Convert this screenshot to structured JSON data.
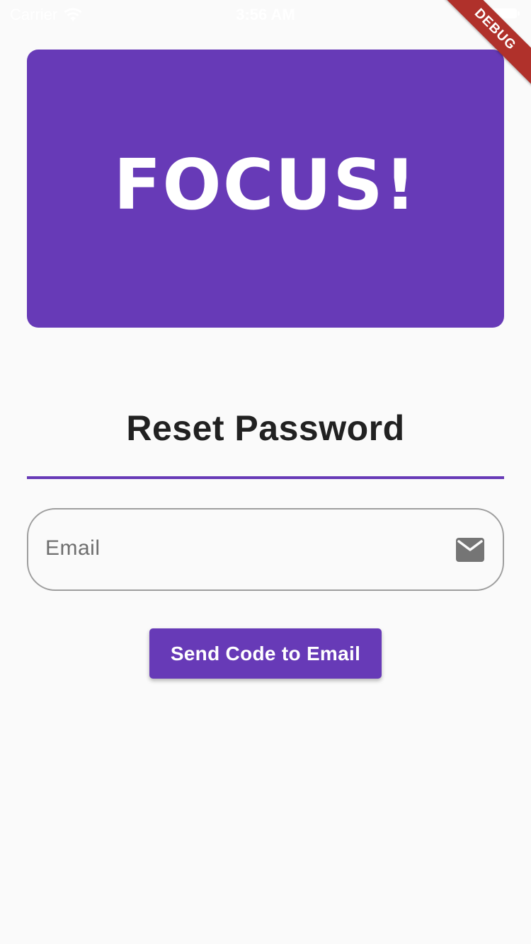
{
  "status_bar": {
    "carrier": "Carrier",
    "time": "3:56 AM",
    "wifi_icon": "wifi-icon",
    "battery_icon": "battery-icon"
  },
  "debug_banner": {
    "label": "DEBUG",
    "color": "#b0312b"
  },
  "hero": {
    "logo_text": "FOCUS!",
    "background_color": "#673ab7"
  },
  "form": {
    "title": "Reset Password",
    "email_field": {
      "placeholder": "Email",
      "value": "",
      "icon": "mail-icon"
    },
    "submit_label": "Send Code to Email"
  },
  "colors": {
    "accent": "#673ab7",
    "background": "#fafafa",
    "title_text": "#212121",
    "field_border": "#9e9e9e"
  }
}
